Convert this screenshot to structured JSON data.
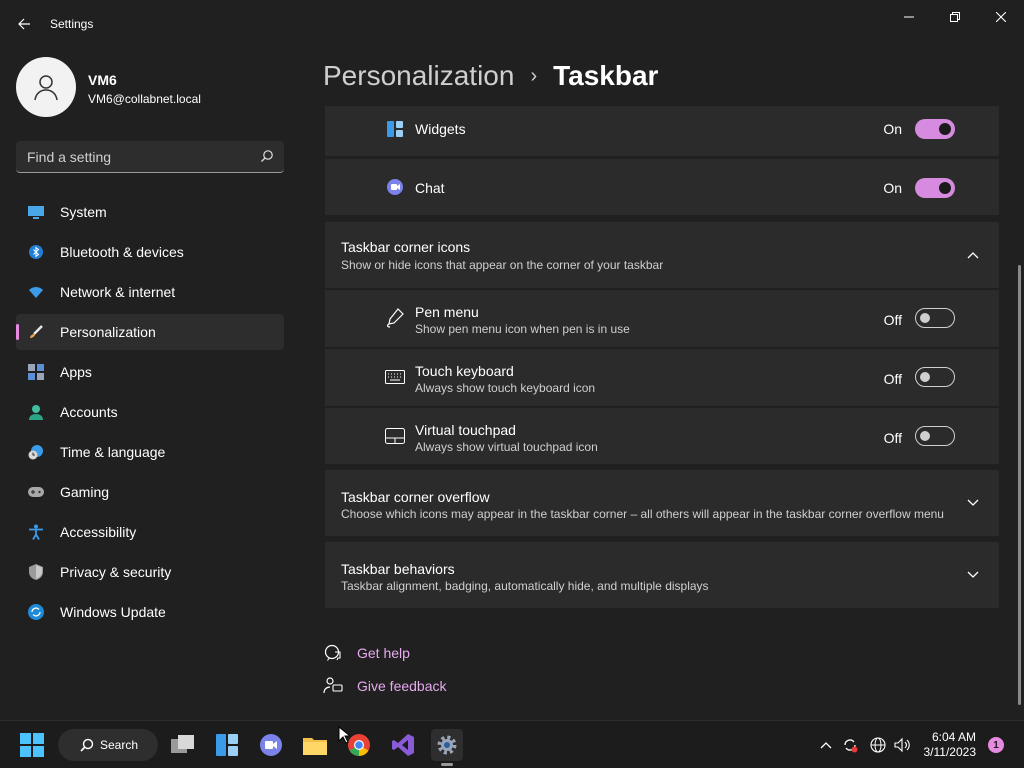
{
  "window": {
    "title": "Settings"
  },
  "user": {
    "name": "VM6",
    "email": "VM6@collabnet.local"
  },
  "search": {
    "placeholder": "Find a setting"
  },
  "nav": {
    "items": [
      {
        "label": "System",
        "icon": "system-icon",
        "active": false
      },
      {
        "label": "Bluetooth & devices",
        "icon": "bluetooth-icon",
        "active": false
      },
      {
        "label": "Network & internet",
        "icon": "wifi-icon",
        "active": false
      },
      {
        "label": "Personalization",
        "icon": "brush-icon",
        "active": true
      },
      {
        "label": "Apps",
        "icon": "apps-icon",
        "active": false
      },
      {
        "label": "Accounts",
        "icon": "accounts-icon",
        "active": false
      },
      {
        "label": "Time & language",
        "icon": "clock-globe-icon",
        "active": false
      },
      {
        "label": "Gaming",
        "icon": "gamepad-icon",
        "active": false
      },
      {
        "label": "Accessibility",
        "icon": "accessibility-icon",
        "active": false
      },
      {
        "label": "Privacy & security",
        "icon": "shield-icon",
        "active": false
      },
      {
        "label": "Windows Update",
        "icon": "update-icon",
        "active": false
      }
    ]
  },
  "breadcrumb": {
    "parent": "Personalization",
    "separator": "›",
    "current": "Taskbar"
  },
  "items": {
    "widgets": {
      "label": "Widgets",
      "state": "On",
      "on": true
    },
    "chat": {
      "label": "Chat",
      "state": "On",
      "on": true
    }
  },
  "corner_icons": {
    "title": "Taskbar corner icons",
    "subtitle": "Show or hide icons that appear on the corner of your taskbar",
    "expanded": true,
    "rows": [
      {
        "label": "Pen menu",
        "sub": "Show pen menu icon when pen is in use",
        "state": "Off"
      },
      {
        "label": "Touch keyboard",
        "sub": "Always show touch keyboard icon",
        "state": "Off"
      },
      {
        "label": "Virtual touchpad",
        "sub": "Always show virtual touchpad icon",
        "state": "Off"
      }
    ]
  },
  "corner_overflow": {
    "title": "Taskbar corner overflow",
    "subtitle": "Choose which icons may appear in the taskbar corner – all others will appear in the taskbar corner overflow menu"
  },
  "behaviors": {
    "title": "Taskbar behaviors",
    "subtitle": "Taskbar alignment, badging, automatically hide, and multiple displays"
  },
  "links": {
    "help": "Get help",
    "feedback": "Give feedback"
  },
  "taskbar": {
    "search_label": "Search",
    "time": "6:04 AM",
    "date": "3/11/2023",
    "notification_count": "1"
  },
  "colors": {
    "accent": "#e58ae0",
    "toggle_on": "#d68ae0",
    "link": "#e7a9ef"
  }
}
